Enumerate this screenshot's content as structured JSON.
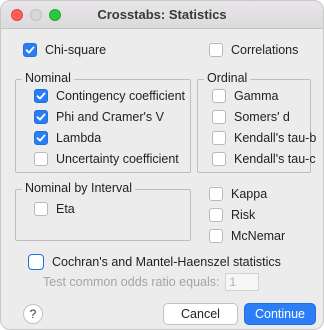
{
  "window": {
    "title": "Crosstabs: Statistics"
  },
  "top": {
    "chi_square": {
      "label": "Chi-square",
      "checked": true
    },
    "correlations": {
      "label": "Correlations",
      "checked": false
    }
  },
  "nominal": {
    "title": "Nominal",
    "items": [
      {
        "label": "Contingency coefficient",
        "checked": true
      },
      {
        "label": "Phi and Cramer's V",
        "checked": true
      },
      {
        "label": "Lambda",
        "checked": true
      },
      {
        "label": "Uncertainty coefficient",
        "checked": false
      }
    ]
  },
  "ordinal": {
    "title": "Ordinal",
    "items": [
      {
        "label": "Gamma",
        "checked": false
      },
      {
        "label": "Somers' d",
        "checked": false
      },
      {
        "label": "Kendall's tau-b",
        "checked": false
      },
      {
        "label": "Kendall's tau-c",
        "checked": false
      }
    ]
  },
  "nominal_by_interval": {
    "title": "Nominal by Interval",
    "items": [
      {
        "label": "Eta",
        "checked": false
      }
    ]
  },
  "other": {
    "items": [
      {
        "label": "Kappa",
        "checked": false
      },
      {
        "label": "Risk",
        "checked": false
      },
      {
        "label": "McNemar",
        "checked": false
      }
    ]
  },
  "cochran": {
    "label": "Cochran's and Mantel-Haenszel statistics",
    "checked": false
  },
  "odds": {
    "label": "Test common odds ratio equals:",
    "value": "1"
  },
  "buttons": {
    "help": "?",
    "cancel": "Cancel",
    "continue": "Continue"
  },
  "colors": {
    "accent": "#2a7df5",
    "close": "#ff5f57",
    "zoom": "#2ac840"
  }
}
